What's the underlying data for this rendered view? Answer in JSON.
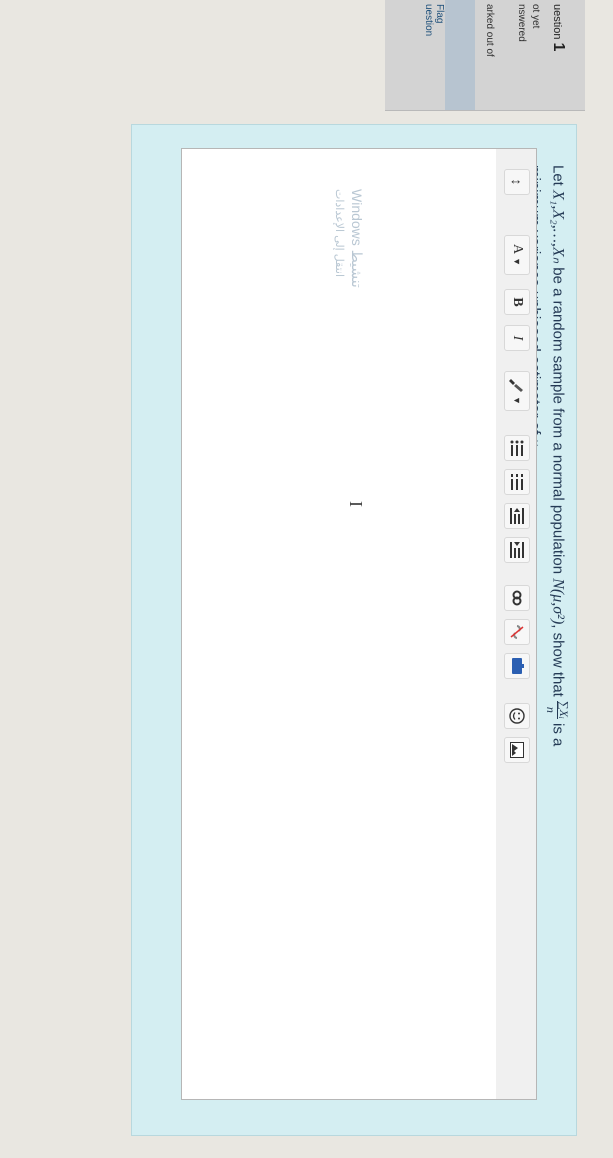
{
  "question_info": {
    "question_label": "uestion",
    "question_number": "1",
    "status_line1": "ot yet",
    "status_line2": "nswered",
    "marks_line": "arked out of",
    "flag_line1": "Flag",
    "flag_line2": "uestion"
  },
  "question": {
    "prefix": "Let ",
    "variables": "X₁,X₂,…,Xₙ",
    "middle": " be a random sample from a normal population ",
    "distribution": "N(μ,σ²)",
    "show_that": ", show that ",
    "fraction_num": "∑Xᵢ",
    "fraction_den": "n",
    "is_a": " is a",
    "line2_prefix": "minimum variance unbiased estimator of ",
    "mu": "μ",
    "line2_suffix": "."
  },
  "toolbar": {
    "collapse_label": "↕",
    "font_label": "A",
    "bold_label": "B",
    "italic_label": "I"
  },
  "watermark": {
    "line1": "Windows تنشيط",
    "line2": "انتقل إلى الإعدادات"
  },
  "colors": {
    "panel": "#d4eef2",
    "question_text": "#243a55",
    "info_bg": "#d3d3d3"
  }
}
